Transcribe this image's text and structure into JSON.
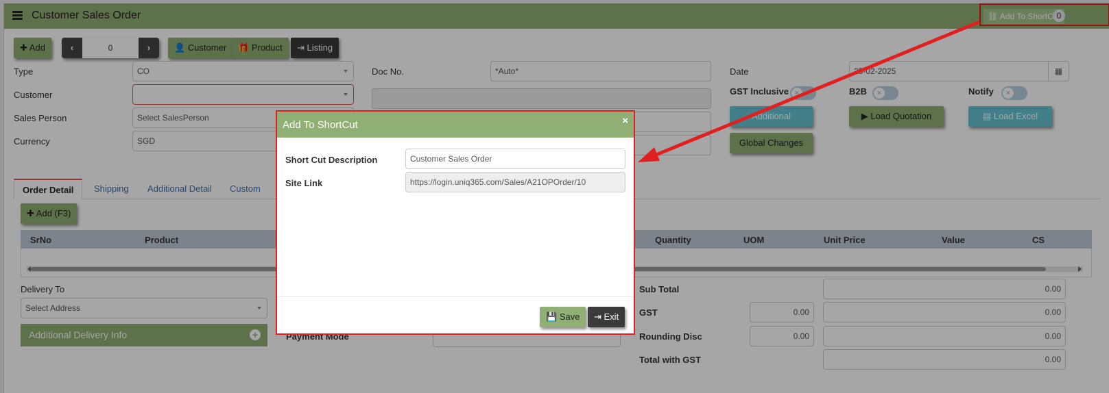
{
  "header": {
    "title": "Customer Sales Order",
    "shortcut_label": "Add To ShortCut",
    "shortcut_count": "0"
  },
  "toolbar": {
    "add_label": "Add",
    "nav_value": "0",
    "customer_label": "Customer",
    "product_label": "Product",
    "listing_label": "Listing"
  },
  "form": {
    "type_label": "Type",
    "type_value": "CO",
    "customer_label": "Customer",
    "customer_value": "",
    "salesperson_label": "Sales Person",
    "salesperson_placeholder": "Select SalesPerson",
    "currency_label": "Currency",
    "currency_value": "SGD",
    "docno_label": "Doc No.",
    "docno_value": "*Auto*",
    "date_label": "Date",
    "date_value": "25-02-2025",
    "gst_inclusive_label": "GST Inclusive",
    "b2b_label": "B2B",
    "notify_label": "Notify",
    "additional_label": "Additional",
    "load_quotation_label": "Load Quotation",
    "load_excel_label": "Load Excel",
    "global_changes_label": "Global Changes"
  },
  "tabs": [
    "Order Detail",
    "Shipping",
    "Additional Detail",
    "Custom"
  ],
  "grid": {
    "add_label": "Add (F3)",
    "columns": [
      "SrNo",
      "Product",
      "Quantity",
      "UOM",
      "Unit Price",
      "Value",
      "CS"
    ]
  },
  "bottom": {
    "delivery_to_label": "Delivery To",
    "address_placeholder": "Select Address",
    "additional_delivery_label": "Additional Delivery Info",
    "payment_mode_label": "Payment Mode",
    "subtotal_label": "Sub Total",
    "subtotal_value": "0.00",
    "gst_label": "GST",
    "gst_rate": "0.00",
    "gst_value": "0.00",
    "rounding_label": "Rounding Disc",
    "rounding_rate": "0.00",
    "rounding_value": "0.00",
    "total_label": "Total with GST",
    "total_value": "0.00"
  },
  "modal": {
    "title": "Add To ShortCut",
    "close": "×",
    "desc_label": "Short Cut Description",
    "desc_value": "Customer Sales Order",
    "link_label": "Site Link",
    "link_value": "https://login.uniq365.com/Sales/A21OPOrder/10",
    "save_label": "Save",
    "exit_label": "Exit"
  },
  "colors": {
    "header_green": "#8faf74",
    "highlight_red": "#e02020",
    "teal": "#66c4d1"
  }
}
